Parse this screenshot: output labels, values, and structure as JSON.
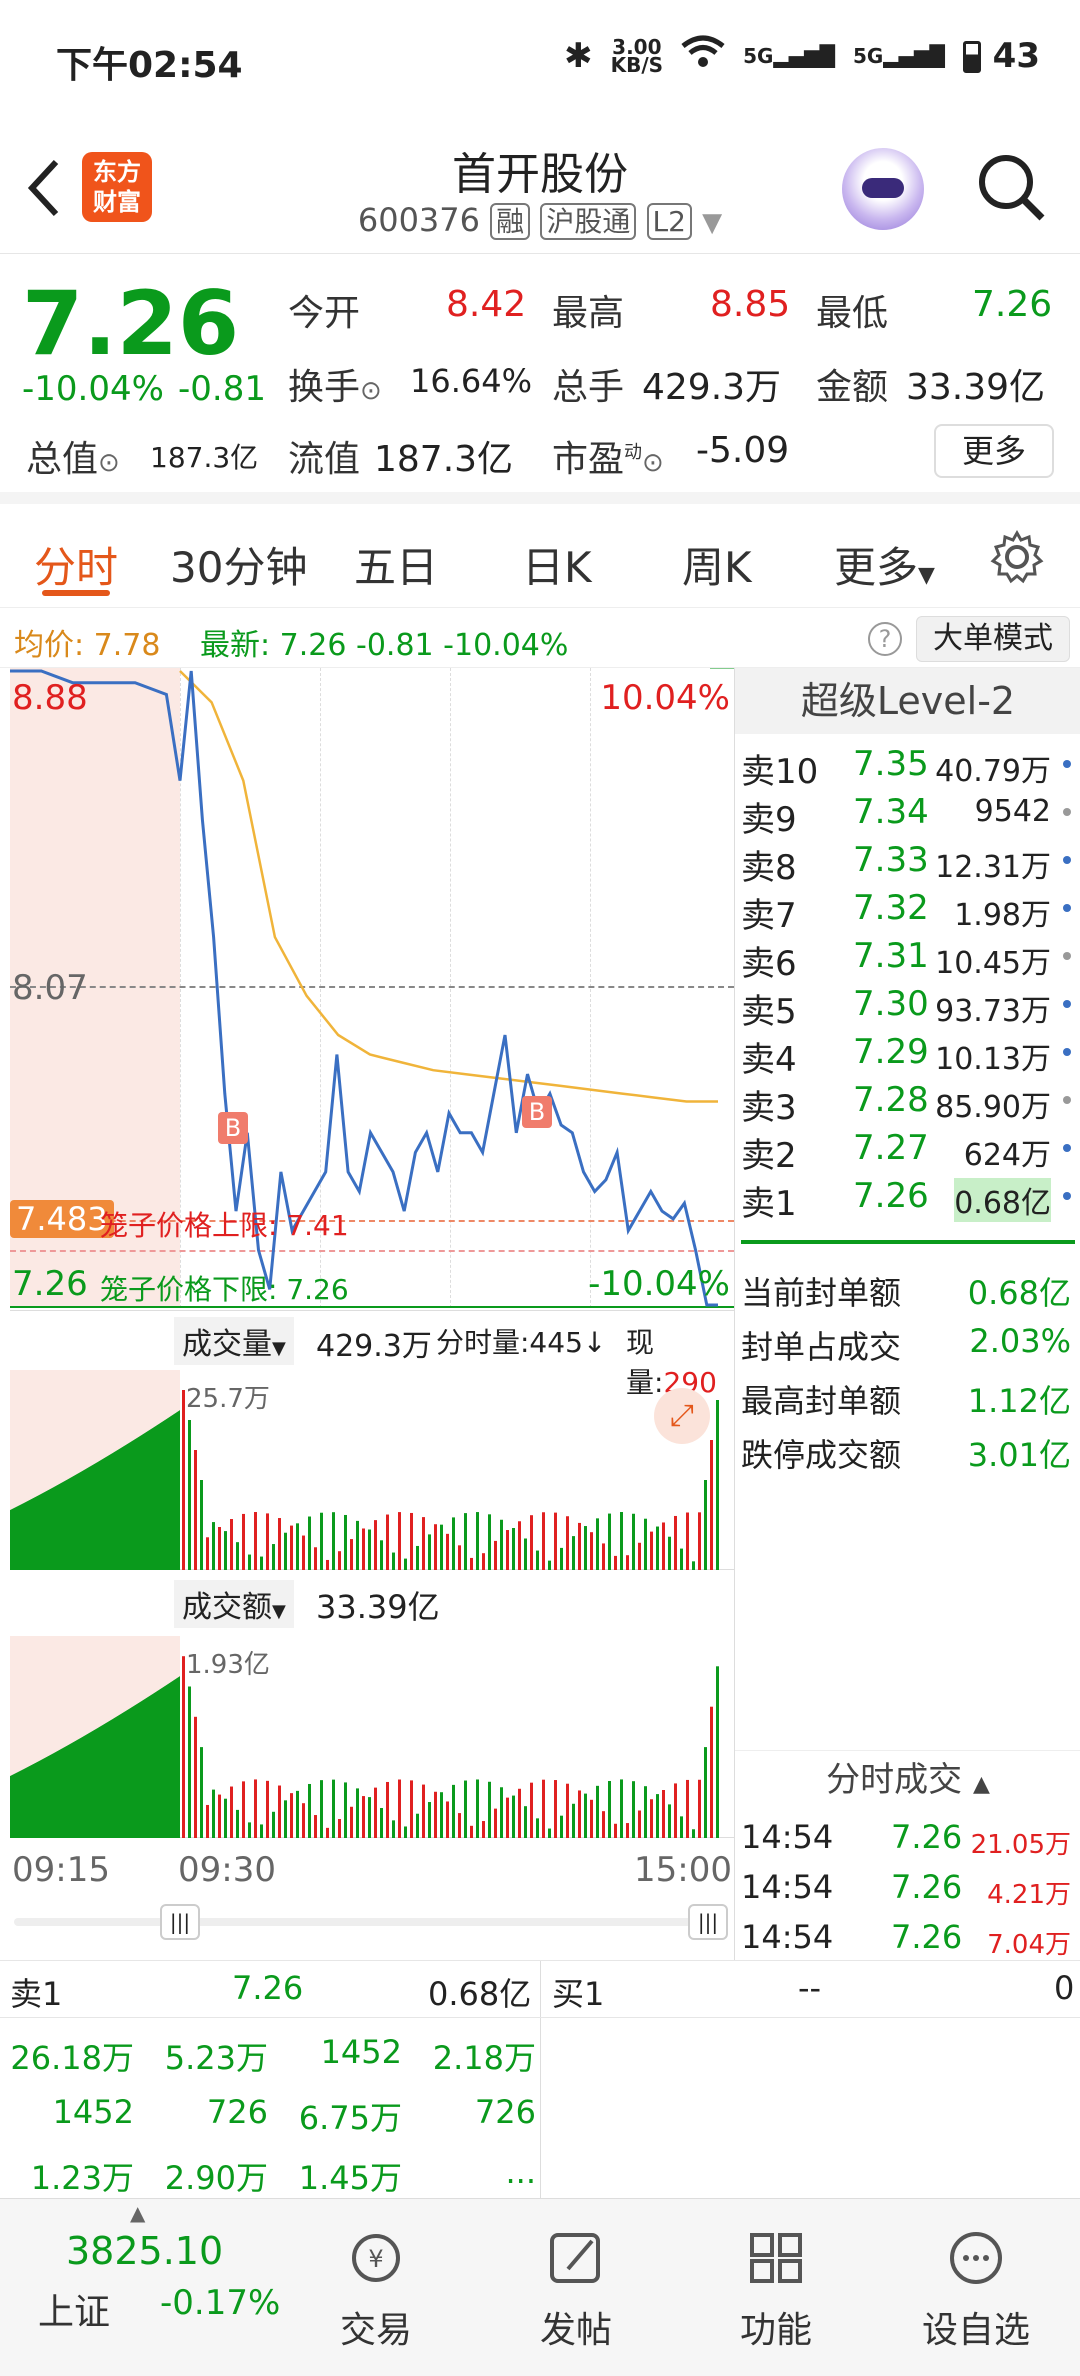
{
  "status_bar": {
    "time": "下午02:54",
    "speed": "3.00",
    "speed_unit": "KB/S",
    "net1": "5G",
    "net2": "5G",
    "battery": "43"
  },
  "header": {
    "logo_line1": "东方",
    "logo_line2": "财富",
    "title": "首开股份",
    "code": "600376",
    "tag_margin": "融",
    "tag_hk": "沪股通",
    "tag_level": "L2"
  },
  "quote": {
    "price": "7.26",
    "change_pct": "-10.04%",
    "change": "-0.81",
    "open_label": "今开",
    "open": "8.42",
    "high_label": "最高",
    "high": "8.85",
    "low_label": "最低",
    "low": "7.26",
    "turnover_label": "换手",
    "turnover": "16.64%",
    "volume_label": "总手",
    "volume": "429.3万",
    "amount_label": "金额",
    "amount": "33.39亿",
    "mktcap_label": "总值",
    "mktcap": "187.3亿",
    "float_label": "流值",
    "float": "187.3亿",
    "pe_label": "市盈",
    "pe_sup": "动",
    "pe": "-5.09",
    "more_button": "更多"
  },
  "tabs": [
    "分时",
    "30分钟",
    "五日",
    "日K",
    "周K",
    "更多"
  ],
  "avg_bar": {
    "avg_label": "均价:",
    "avg": "7.78",
    "latest_label": "最新:",
    "latest": "7.26",
    "chg": "-0.81",
    "pct": "-10.04%",
    "mode_button": "大单模式"
  },
  "chart": {
    "y_top": "8.88",
    "y_mid": "8.07",
    "top_pct": "10.04%",
    "cursor_price": "7.483",
    "cage_upper": "笼子价格上限:  7.41",
    "cage_lower_price": "7.26",
    "cage_lower": "笼子价格下限:  7.26",
    "bottom_pct": "-10.04%",
    "marker": "B",
    "prices": [
      8.88,
      8.88,
      8.85,
      8.85,
      8.85,
      8.82,
      8.6,
      8.88,
      8.5,
      8.2,
      7.8,
      7.5,
      7.7,
      7.4,
      7.3,
      7.6,
      7.45,
      7.5,
      7.55,
      7.6,
      7.9,
      7.6,
      7.55,
      7.7,
      7.65,
      7.6,
      7.5,
      7.65,
      7.7,
      7.6,
      7.75,
      7.7,
      7.7,
      7.65,
      7.8,
      7.95,
      7.7,
      7.85,
      7.75,
      7.8,
      7.72,
      7.7,
      7.6,
      7.55,
      7.58,
      7.65,
      7.45,
      7.5,
      7.55,
      7.5,
      7.48,
      7.52,
      7.4,
      7.26,
      7.26
    ],
    "avg": [
      8.88,
      8.8,
      8.6,
      8.2,
      8.05,
      7.95,
      7.9,
      7.88,
      7.86,
      7.85,
      7.84,
      7.83,
      7.82,
      7.81,
      7.8,
      7.79,
      7.78,
      7.78
    ]
  },
  "volume_panel": {
    "label": "成交量",
    "total": "429.3万",
    "min_label": "分时量:445",
    "now_label": "现量:",
    "now": "290",
    "peak": "25.7万"
  },
  "amount_panel": {
    "label": "成交额",
    "total": "33.39亿",
    "peak": "1.93亿"
  },
  "time_axis": [
    "09:15",
    "09:30",
    "15:00"
  ],
  "book": {
    "title": "超级Level-2",
    "rows": [
      {
        "side": "卖10",
        "price": "7.35",
        "vol": "40.79万"
      },
      {
        "side": "卖9",
        "price": "7.34",
        "vol": "9542"
      },
      {
        "side": "卖8",
        "price": "7.33",
        "vol": "12.31万"
      },
      {
        "side": "卖7",
        "price": "7.32",
        "vol": "1.98万"
      },
      {
        "side": "卖6",
        "price": "7.31",
        "vol": "10.45万"
      },
      {
        "side": "卖5",
        "price": "7.30",
        "vol": "93.73万"
      },
      {
        "side": "卖4",
        "price": "7.29",
        "vol": "10.13万"
      },
      {
        "side": "卖3",
        "price": "7.28",
        "vol": "85.90万"
      },
      {
        "side": "卖2",
        "price": "7.27",
        "vol": "624万"
      },
      {
        "side": "卖1",
        "price": "7.26",
        "vol": "0.68亿"
      }
    ],
    "seal": [
      {
        "label": "当前封单额",
        "value": "0.68亿"
      },
      {
        "label": "封单占成交",
        "value": "2.03%"
      },
      {
        "label": "最高封单额",
        "value": "1.12亿"
      },
      {
        "label": "跌停成交额",
        "value": "3.01亿"
      }
    ],
    "trades_title": "分时成交",
    "trades": [
      {
        "time": "14:54",
        "price": "7.26",
        "vol": "21.05万"
      },
      {
        "time": "14:54",
        "price": "7.26",
        "vol": "4.21万"
      },
      {
        "time": "14:54",
        "price": "7.26",
        "vol": "7.04万"
      }
    ]
  },
  "bottom_table": {
    "sell1": "卖1",
    "sell1_price": "7.26",
    "sell1_vol": "0.68亿",
    "buy1": "买1",
    "buy1_price": "--",
    "buy1_vol": "0",
    "cells": [
      [
        "26.18万",
        "5.23万",
        "1452",
        "2.18万"
      ],
      [
        "1452",
        "726",
        "6.75万",
        "726"
      ],
      [
        "1.23万",
        "2.90万",
        "1.45万",
        "..."
      ]
    ]
  },
  "nav": {
    "index_value": "3825.10",
    "index_name": "上证",
    "index_pct": "-0.17%",
    "items": [
      "交易",
      "发帖",
      "功能",
      "设自选"
    ]
  }
}
